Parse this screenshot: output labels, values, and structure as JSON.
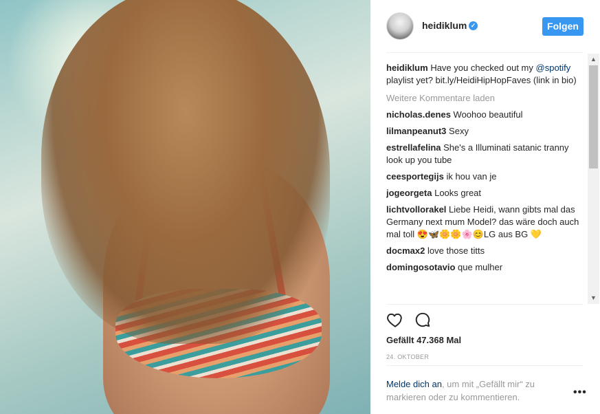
{
  "post": {
    "username": "heidiklum",
    "follow_label": "Folgen",
    "caption": {
      "username": "heidiklum",
      "text_before": "Have you checked out my",
      "mention": "@spotify",
      "text_after": "playlist yet? bit.ly/HeidiHipHopFaves (link in bio)"
    },
    "load_more": "Weitere Kommentare laden",
    "comments": [
      {
        "username": "nicholas.denes",
        "text": "Woohoo beautiful"
      },
      {
        "username": "lilmanpeanut3",
        "text": "Sexy"
      },
      {
        "username": "estrellafelina",
        "text": "She's a Illuminati satanic tranny look up you tube"
      },
      {
        "username": "ceesportegijs",
        "text": "ik hou van je"
      },
      {
        "username": "jogeorgeta",
        "text": "Looks great"
      },
      {
        "username": "lichtvollorakel",
        "text": "Liebe Heidi, wann gibts mal das Germany next mum Model? das wäre doch auch mal toll 😍🦋🌼🌼🌸😊LG aus BG 💛"
      },
      {
        "username": "docmax2",
        "text": "love those titts"
      },
      {
        "username": "domingosotavio",
        "text": "que mulher"
      }
    ],
    "likes": "Gefällt 47.368 Mal",
    "date": "24. OKTOBER",
    "login": {
      "link": "Melde dich an",
      "text": ", um mit „Gefällt mir“ zu markieren oder zu kommentieren."
    },
    "more_label": "•••"
  },
  "colors": {
    "accent": "#3897f0",
    "link": "#003569",
    "muted": "#999999"
  }
}
